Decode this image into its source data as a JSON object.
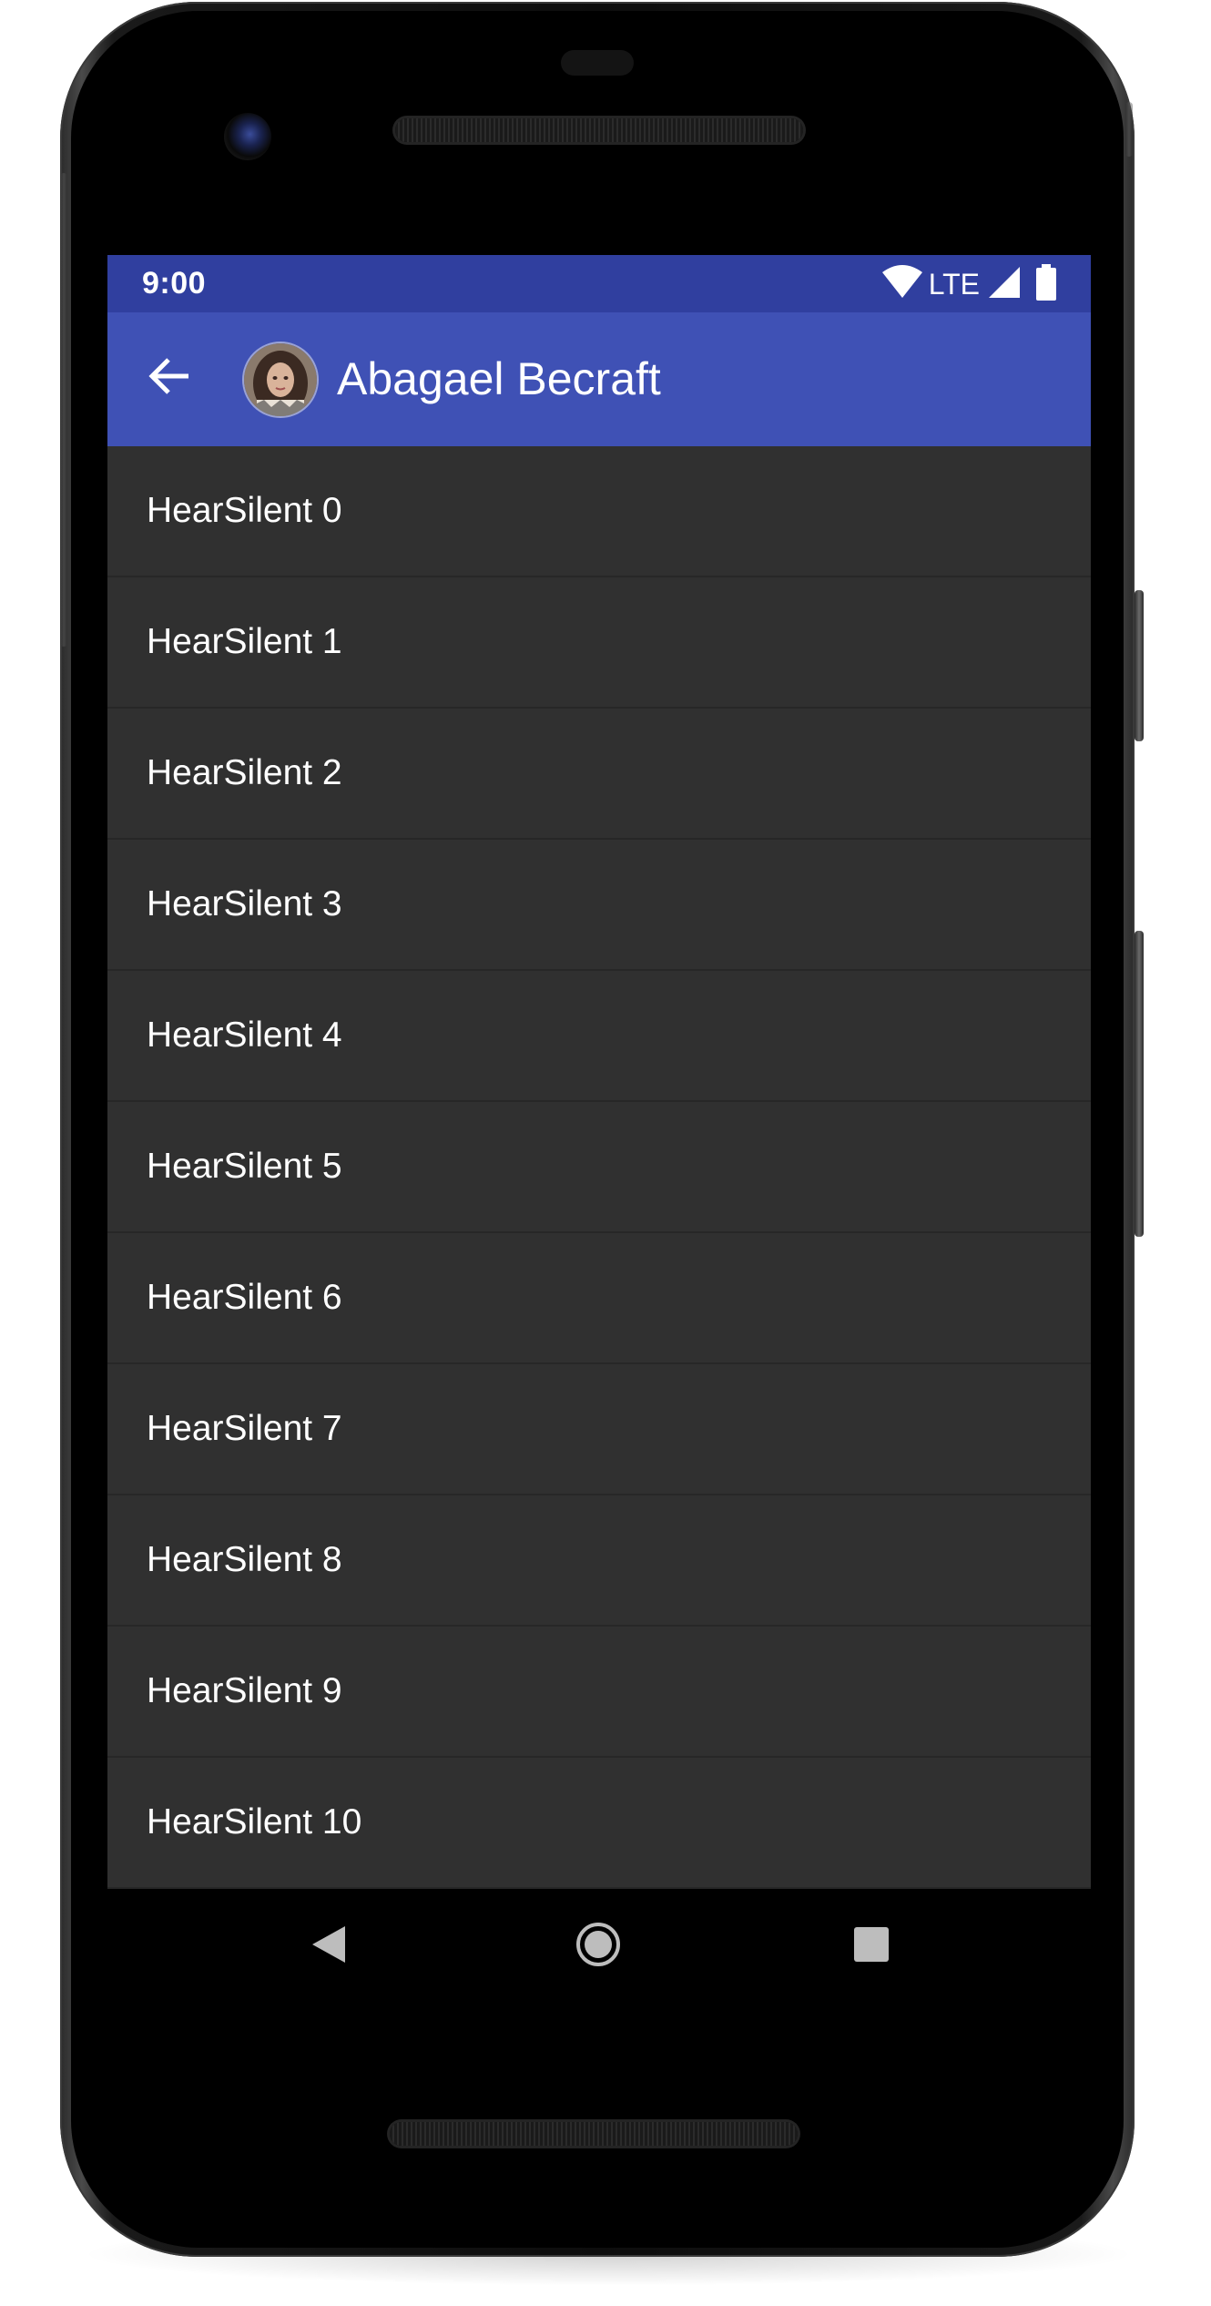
{
  "status_bar": {
    "time": "9:00",
    "network_label": "LTE",
    "color": "#303f9f"
  },
  "app_bar": {
    "title": "Abagael Becraft",
    "color": "#3f51b5",
    "back_icon": "arrow-back-icon",
    "avatar_icon": "contact-avatar"
  },
  "list": {
    "background": "#303030",
    "items": [
      {
        "label": "HearSilent 0"
      },
      {
        "label": "HearSilent 1"
      },
      {
        "label": "HearSilent 2"
      },
      {
        "label": "HearSilent 3"
      },
      {
        "label": "HearSilent 4"
      },
      {
        "label": "HearSilent 5"
      },
      {
        "label": "HearSilent 6"
      },
      {
        "label": "HearSilent 7"
      },
      {
        "label": "HearSilent 8"
      },
      {
        "label": "HearSilent 9"
      },
      {
        "label": "HearSilent 10"
      }
    ]
  },
  "nav_bar": {
    "back_icon": "triangle-back-icon",
    "home_icon": "circle-home-icon",
    "recents_icon": "square-recents-icon"
  }
}
